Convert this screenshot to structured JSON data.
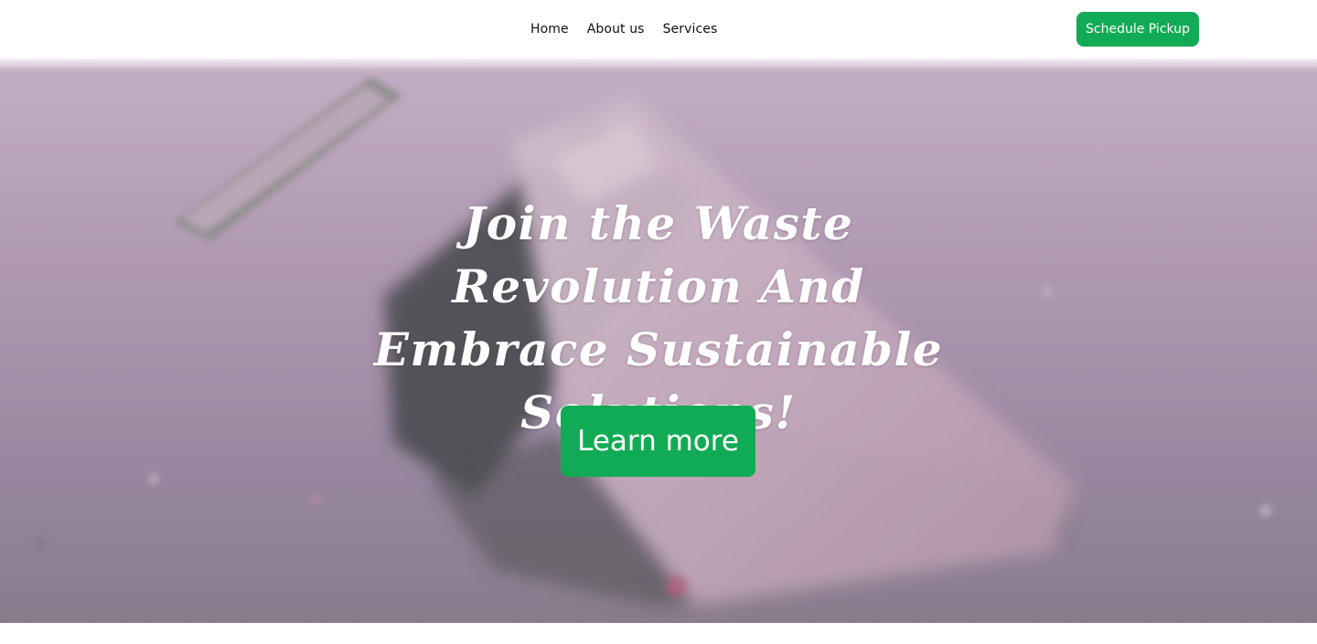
{
  "colors": {
    "accent": "#12ab55",
    "nav_text": "#111111",
    "hero_text": "#ffffff",
    "page_background": "#ffffff"
  },
  "nav": {
    "links": [
      {
        "label": "Home"
      },
      {
        "label": "About us"
      },
      {
        "label": "Services"
      }
    ],
    "cta_label": "Schedule Pickup"
  },
  "hero": {
    "title": "Join the Waste Revolution And Embrace Sustainable Solutions!",
    "button_label": "Learn more",
    "background_image": "blurred-trash-bin-photo"
  }
}
